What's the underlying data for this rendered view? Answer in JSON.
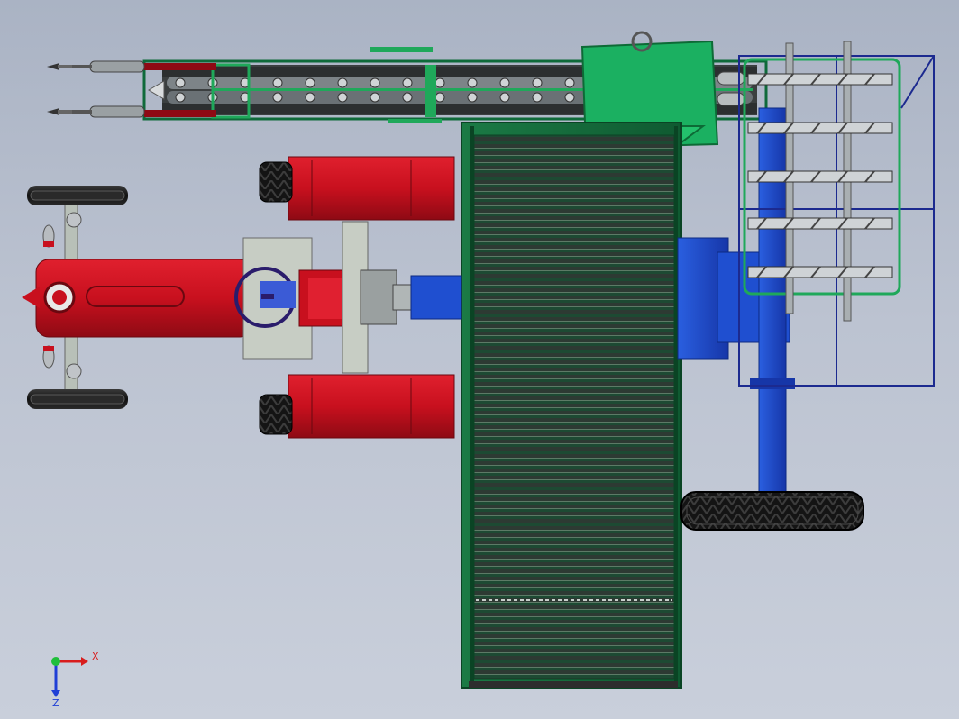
{
  "viewport": {
    "view": "top",
    "background_top": "#aab3c4",
    "background_bottom": "#c9cfdb"
  },
  "model": {
    "tractor": {
      "body_color": "#c8101e",
      "wheel_color": "#1b1b1b",
      "hub_color": "#b8c0b8"
    },
    "conveyor": {
      "frame_color": "#0f6a3a",
      "slat_color": "#2a3b33"
    },
    "header": {
      "frame_color": "#1fa85a",
      "roller_color": "#8a8f92"
    },
    "hopper": {
      "color": "#1bb061"
    },
    "rear_unit": {
      "color": "#1f4fd0",
      "cage_color": "#1c2a8f"
    }
  },
  "triad": {
    "x_label": "X",
    "z_label": "Z",
    "x_color": "#d81d1d",
    "y_color": "#1fbf3a",
    "z_color": "#1f3fd6"
  }
}
